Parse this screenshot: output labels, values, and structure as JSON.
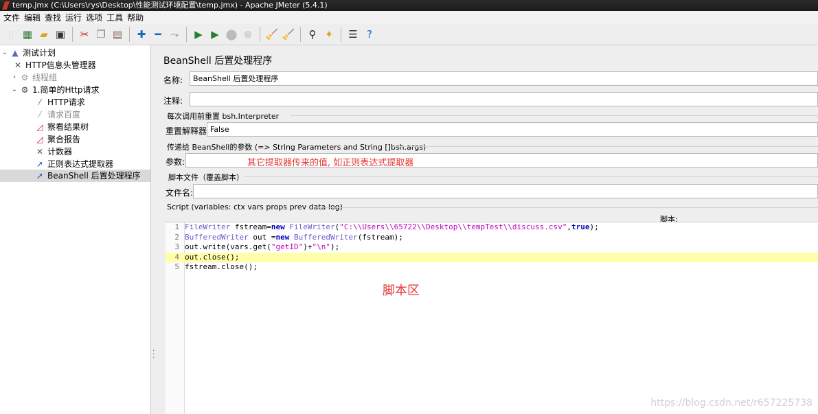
{
  "window": {
    "title": "temp.jmx (C:\\Users\\rys\\Desktop\\性能测试环境配置\\temp.jmx) - Apache JMeter (5.4.1)"
  },
  "menu": [
    "文件",
    "编辑",
    "查找",
    "运行",
    "选项",
    "工具",
    "帮助"
  ],
  "tree": {
    "root": "测试计划",
    "http_header": "HTTP信息头管理器",
    "thread_group_1": "线程组",
    "thread_group_2": "1.简单的Http请求",
    "http_request": "HTTP请求",
    "baidu_request": "请求百度",
    "results_tree": "察看结果树",
    "aggregate_report": "聚合报告",
    "counter": "计数器",
    "regex_extractor": "正则表达式提取器",
    "beanshell_post": "BeanShell 后置处理程序"
  },
  "panel": {
    "title": "BeanShell 后置处理程序",
    "name_label": "名称:",
    "name_value": "BeanShell 后置处理程序",
    "comment_label": "注释:",
    "comment_value": "",
    "reset_group_title": "每次调用前重置 bsh.Interpreter",
    "reset_label": "重置解释器:",
    "reset_value": "False",
    "params_group_title": "传递给 BeanShell的参数 (=> String Parameters and String []bsh.args)",
    "params_label": "参数:",
    "params_value": "",
    "file_group_title": "脚本文件（覆盖脚本）",
    "file_label": "文件名:",
    "file_value": "",
    "script_group_title": "Script (variables: ctx vars props prev data log)",
    "script_label": "脚本:"
  },
  "code": {
    "l1_type": "FileWriter",
    "l1_a": " fstream=",
    "l1_new": "new",
    "l1_b": " ",
    "l1_type2": "FileWriter",
    "l1_c": "(",
    "l1_str": "\"C:\\\\Users\\\\65722\\\\Desktop\\\\tempTest\\\\discuss.csv\"",
    "l1_d": ",",
    "l1_true": "true",
    "l1_e": ");",
    "l2_type": "BufferedWriter",
    "l2_a": " out =",
    "l2_new": "new",
    "l2_b": " ",
    "l2_type2": "BufferedWriter",
    "l2_c": "(fstream);",
    "l3_a": "out.write(vars.get(",
    "l3_str1": "\"getID\"",
    "l3_b": ")+",
    "l3_str2": "\"\\n\"",
    "l3_c": ");",
    "l4": "out.close();",
    "l5": "fstream.close();"
  },
  "annotations": {
    "params_note": "其它提取器传来的值, 如正则表达式提取器",
    "script_area_note": "脚本区",
    "watermark": "https://blog.csdn.net/r657225738"
  },
  "colors": {
    "annotation_red": "#e53935",
    "highlight_line": "#ffffaa",
    "keyword": "#0000c0"
  }
}
